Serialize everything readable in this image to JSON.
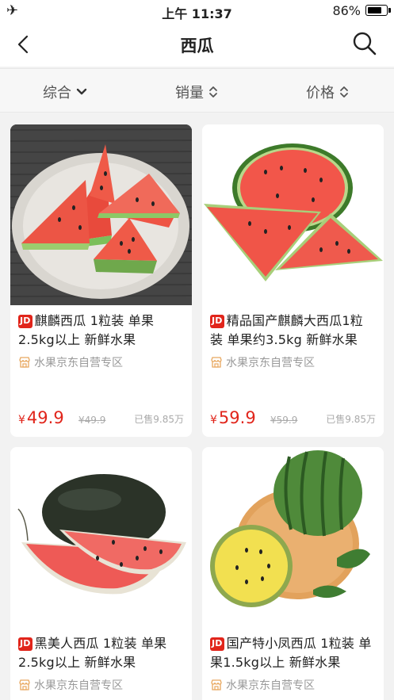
{
  "status_bar": {
    "time": "上午 11:37",
    "battery": "86%",
    "battery_level": 0.86,
    "icons": [
      "airplane-icon",
      "battery-icon"
    ]
  },
  "nav": {
    "title": "西瓜",
    "icons": [
      "back-chevron-icon",
      "search-icon"
    ]
  },
  "sort": {
    "items": [
      {
        "label": "综合",
        "icon": "chevron-down-icon"
      },
      {
        "label": "销量",
        "icon": "sort-updown-icon"
      },
      {
        "label": "价格",
        "icon": "sort-updown-icon"
      }
    ]
  },
  "products": [
    {
      "badge": "JD",
      "name": "麒麟西瓜 1粒装 单果2.5kg以上 新鲜水果",
      "shop": "水果京东自营专区",
      "yen": "¥",
      "price": "49.9",
      "original_price": "¥49.9",
      "sold": "已售9.85万"
    },
    {
      "badge": "JD",
      "name": "精品国产麒麟大西瓜1粒装  单果约3.5kg  新鲜水果",
      "shop": "水果京东自营专区",
      "yen": "¥",
      "price": "59.9",
      "original_price": "¥59.9",
      "sold": "已售9.85万"
    },
    {
      "badge": "JD",
      "name": "黑美人西瓜 1粒装 单果2.5kg以上 新鲜水果",
      "shop": "水果京东自营专区"
    },
    {
      "badge": "JD",
      "name": "国产特小凤西瓜 1粒装 单果1.5kg以上 新鲜水果",
      "shop": "水果京东自营专区"
    }
  ],
  "colors": {
    "accent": "#e1251b",
    "muted": "#999999",
    "background": "#f2f2f2"
  }
}
